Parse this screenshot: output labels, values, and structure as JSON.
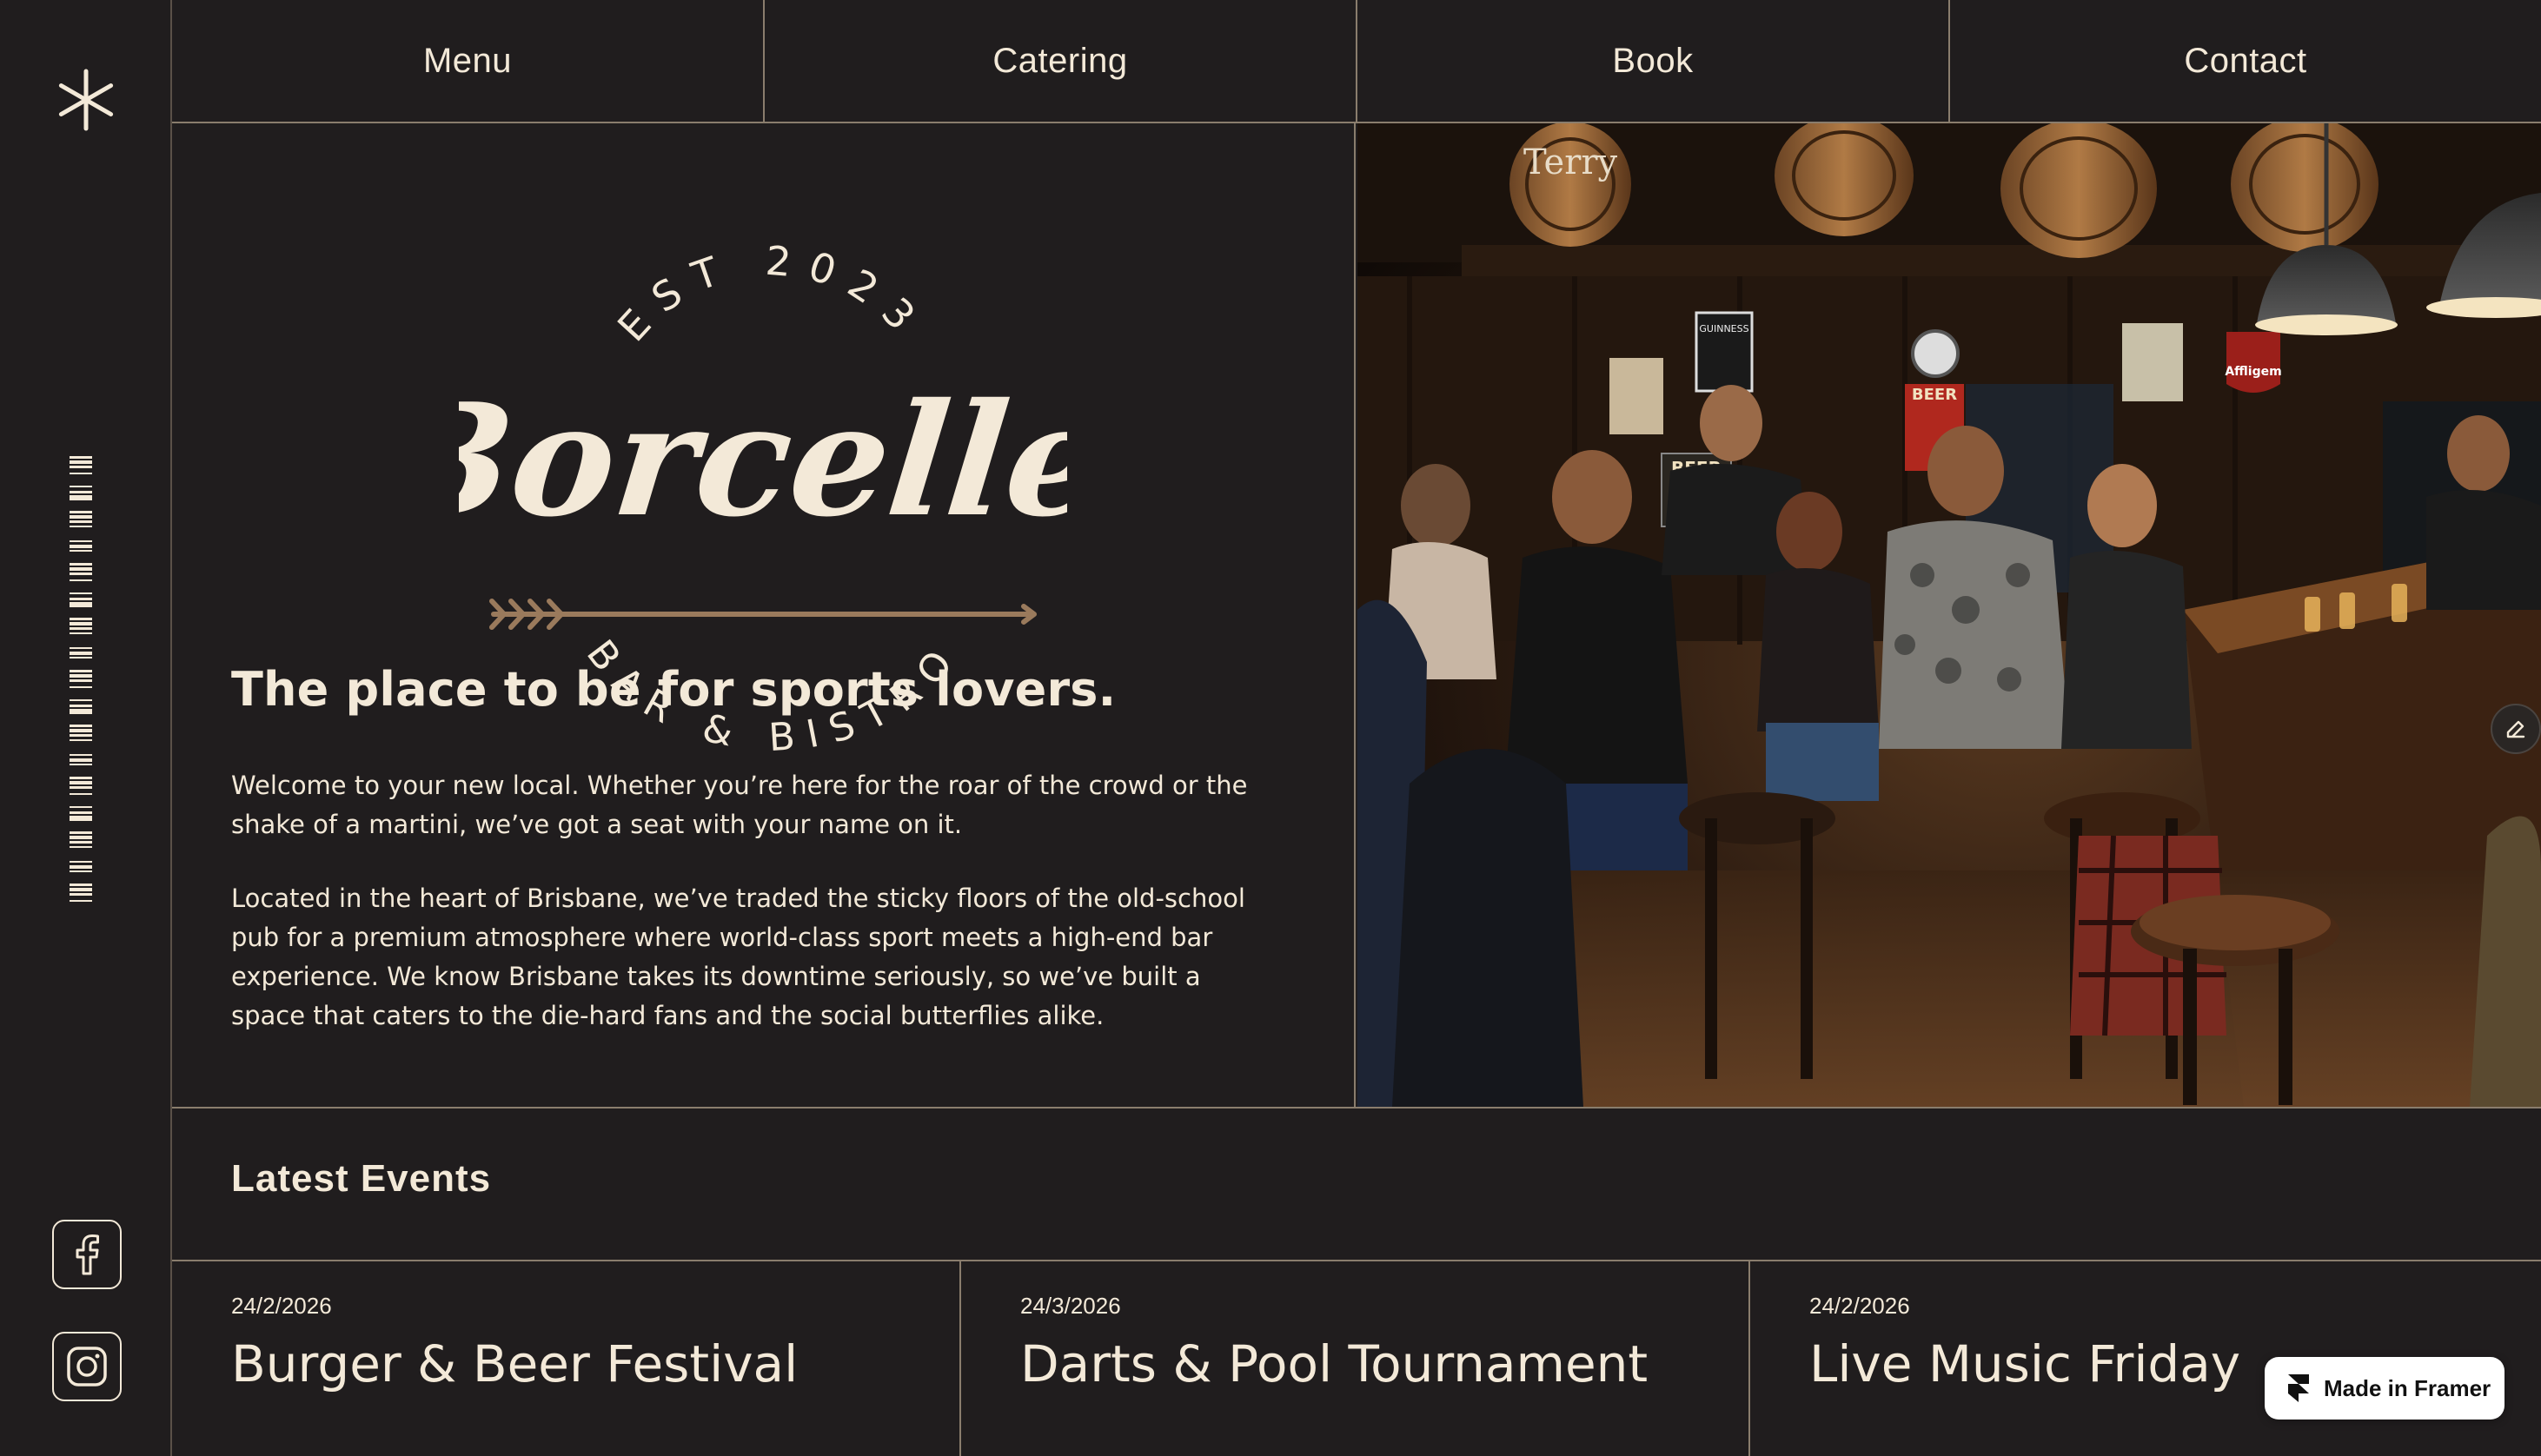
{
  "nav": {
    "items": [
      {
        "label": "Menu"
      },
      {
        "label": "Catering"
      },
      {
        "label": "Book"
      },
      {
        "label": "Contact"
      }
    ]
  },
  "sidebar": {
    "icons": [
      "asterisk-icon",
      "barcode",
      "facebook-icon",
      "instagram-icon"
    ]
  },
  "logo": {
    "top_text": "EST 2023",
    "name": "Borcelle",
    "bottom_text": "BAR & BISTRO"
  },
  "hero": {
    "tagline": "The place to be for sports lovers.",
    "paragraph1": "Welcome to your new local. Whether you’re here for the roar of the crowd or the shake of a martini, we’ve got a seat with your name on it.",
    "paragraph2": "Located in the heart of Brisbane, we’ve traded the sticky floors of the old-school pub for a premium atmosphere where world-class sport meets a high-end bar experience. We know Brisbane takes its downtime seriously, so we’ve built a space that caters to the die-hard fans and the social butterflies alike."
  },
  "photo": {
    "signs": [
      "Terry",
      "BEER",
      "BEER",
      "GUINNESS",
      "Affligem"
    ]
  },
  "events": {
    "title": "Latest Events",
    "items": [
      {
        "date": "24/2/2026",
        "name": "Burger & Beer Festival"
      },
      {
        "date": "24/3/2026",
        "name": "Darts & Pool Tournament"
      },
      {
        "date": "24/2/2026",
        "name": "Live Music Friday"
      }
    ]
  },
  "badge": {
    "label": "Made in Framer"
  },
  "colors": {
    "background": "#201d1e",
    "cream": "#f3e9d8",
    "divider": "#8a7d6d",
    "arrow": "#9a7a5c"
  }
}
